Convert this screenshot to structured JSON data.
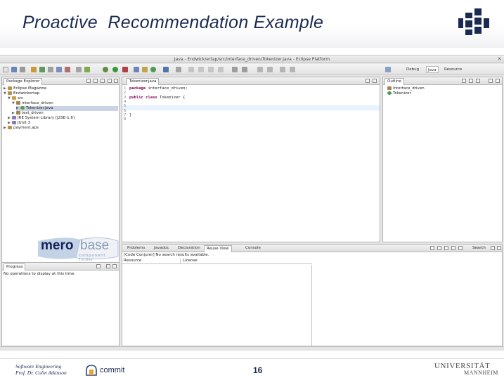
{
  "slide": {
    "title": "Proactive  Recommendation Example",
    "footer_line1": "Software Engineering",
    "footer_line2": "Prof. Dr. Colin Atkinson",
    "page_number": "16",
    "commit_logo": "commit",
    "university_line1": "UNIVERSITÄT",
    "university_line2": "MANNHEIM"
  },
  "eclipse": {
    "window_title": "Java - Endwick/ertap/src/interface_driven/Tokenizer.java - Eclipse Platform",
    "perspectives": [
      "Debug",
      "Java",
      "Resource"
    ],
    "package_explorer": {
      "tab_label": "Package Explorer",
      "tree": [
        "Eclipse Magazine",
        "Endwickertap",
        "src",
        "interface_driven",
        "Tokenizer.java",
        "test_driven",
        "JRE System Library [J2SE-1.6]",
        "JUnit 3",
        "payment.aps"
      ]
    },
    "editor": {
      "tab_label": "Tokenizer.java",
      "lines": [
        {
          "n": "1",
          "code": "package interface_driven;"
        },
        {
          "n": "2",
          "code": ""
        },
        {
          "n": "3",
          "code": "public class Tokenizer {"
        },
        {
          "n": "4",
          "code": ""
        },
        {
          "n": "5",
          "code": ""
        },
        {
          "n": "6",
          "code": ""
        },
        {
          "n": "7",
          "code": "}"
        },
        {
          "n": "8",
          "code": ""
        }
      ]
    },
    "outline": {
      "tab_label": "Outline",
      "items": [
        "interface_driven",
        "Tokenizer"
      ]
    },
    "bottom_tabs": [
      "Problems",
      "Javadoc",
      "Declaration",
      "Reuse View",
      "Console"
    ],
    "reuse_view": {
      "status": "[Code Conjurer] No search results available.",
      "col_resource": "Resource",
      "col_license": "License",
      "search_label": "Search"
    },
    "progress": {
      "tab_label": "Progress",
      "message": "No operations to display at this time."
    }
  },
  "merobase": {
    "word_left": "mero",
    "word_right": "base",
    "tagline": "component finder"
  },
  "colors": {
    "title": "#1a2a52",
    "keyword": "#7f0055",
    "selection": "#c9d3e4"
  }
}
